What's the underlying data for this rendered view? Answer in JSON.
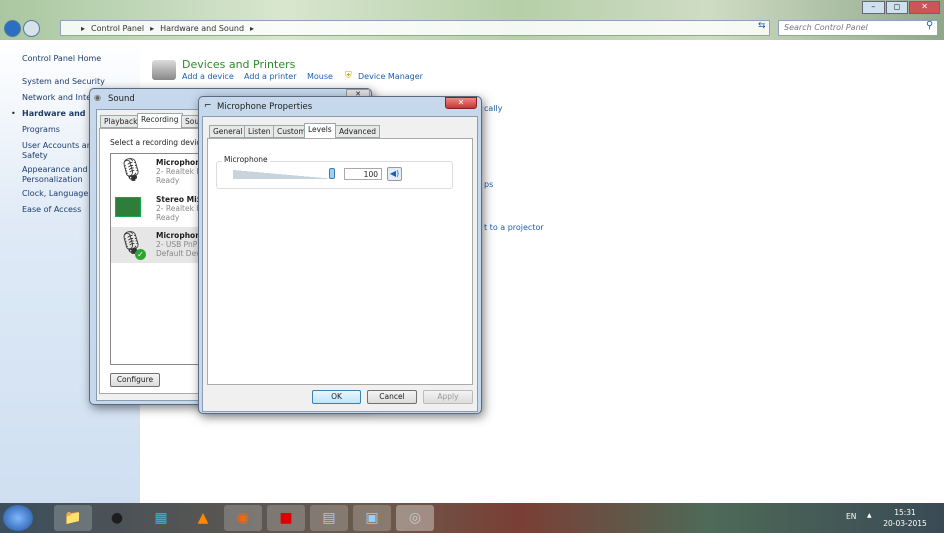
{
  "explorer": {
    "breadcrumb": [
      "Control Panel",
      "Hardware and Sound"
    ],
    "search_placeholder": "Search Control Panel",
    "sidebar": [
      "Control Panel Home",
      "System and Security",
      "Network and Inter",
      "Hardware and So",
      "Programs",
      "User Accounts and",
      "Safety",
      "Appearance and",
      "Personalization",
      "Clock, Language, a",
      "Ease of Access"
    ],
    "section_title": "Devices and Printers",
    "links": [
      "Add a device",
      "Add a printer",
      "Mouse",
      "Device Manager"
    ],
    "partial_links": [
      "cally",
      "ps",
      "t to a projector"
    ]
  },
  "sound": {
    "title": "Sound",
    "tabs": [
      "Playback",
      "Recording",
      "Soun"
    ],
    "instruction": "Select a recording device",
    "devices": [
      {
        "name": "Microphone",
        "driver": "2- Realtek Hi",
        "status": "Ready"
      },
      {
        "name": "Stereo Mix",
        "driver": "2- Realtek Hi",
        "status": "Ready"
      },
      {
        "name": "Microphone",
        "driver": "2- USB PnP S",
        "status": "Default Devi"
      }
    ],
    "configure": "Configure"
  },
  "props": {
    "title": "Microphone Properties",
    "tabs": [
      "General",
      "Listen",
      "Custom",
      "Levels",
      "Advanced"
    ],
    "group": "Microphone",
    "level": 100,
    "level_text": "100",
    "ok": "OK",
    "cancel": "Cancel",
    "apply": "Apply"
  },
  "tray": {
    "lang": "EN",
    "time": "15:31",
    "date": "20-03-2015"
  }
}
